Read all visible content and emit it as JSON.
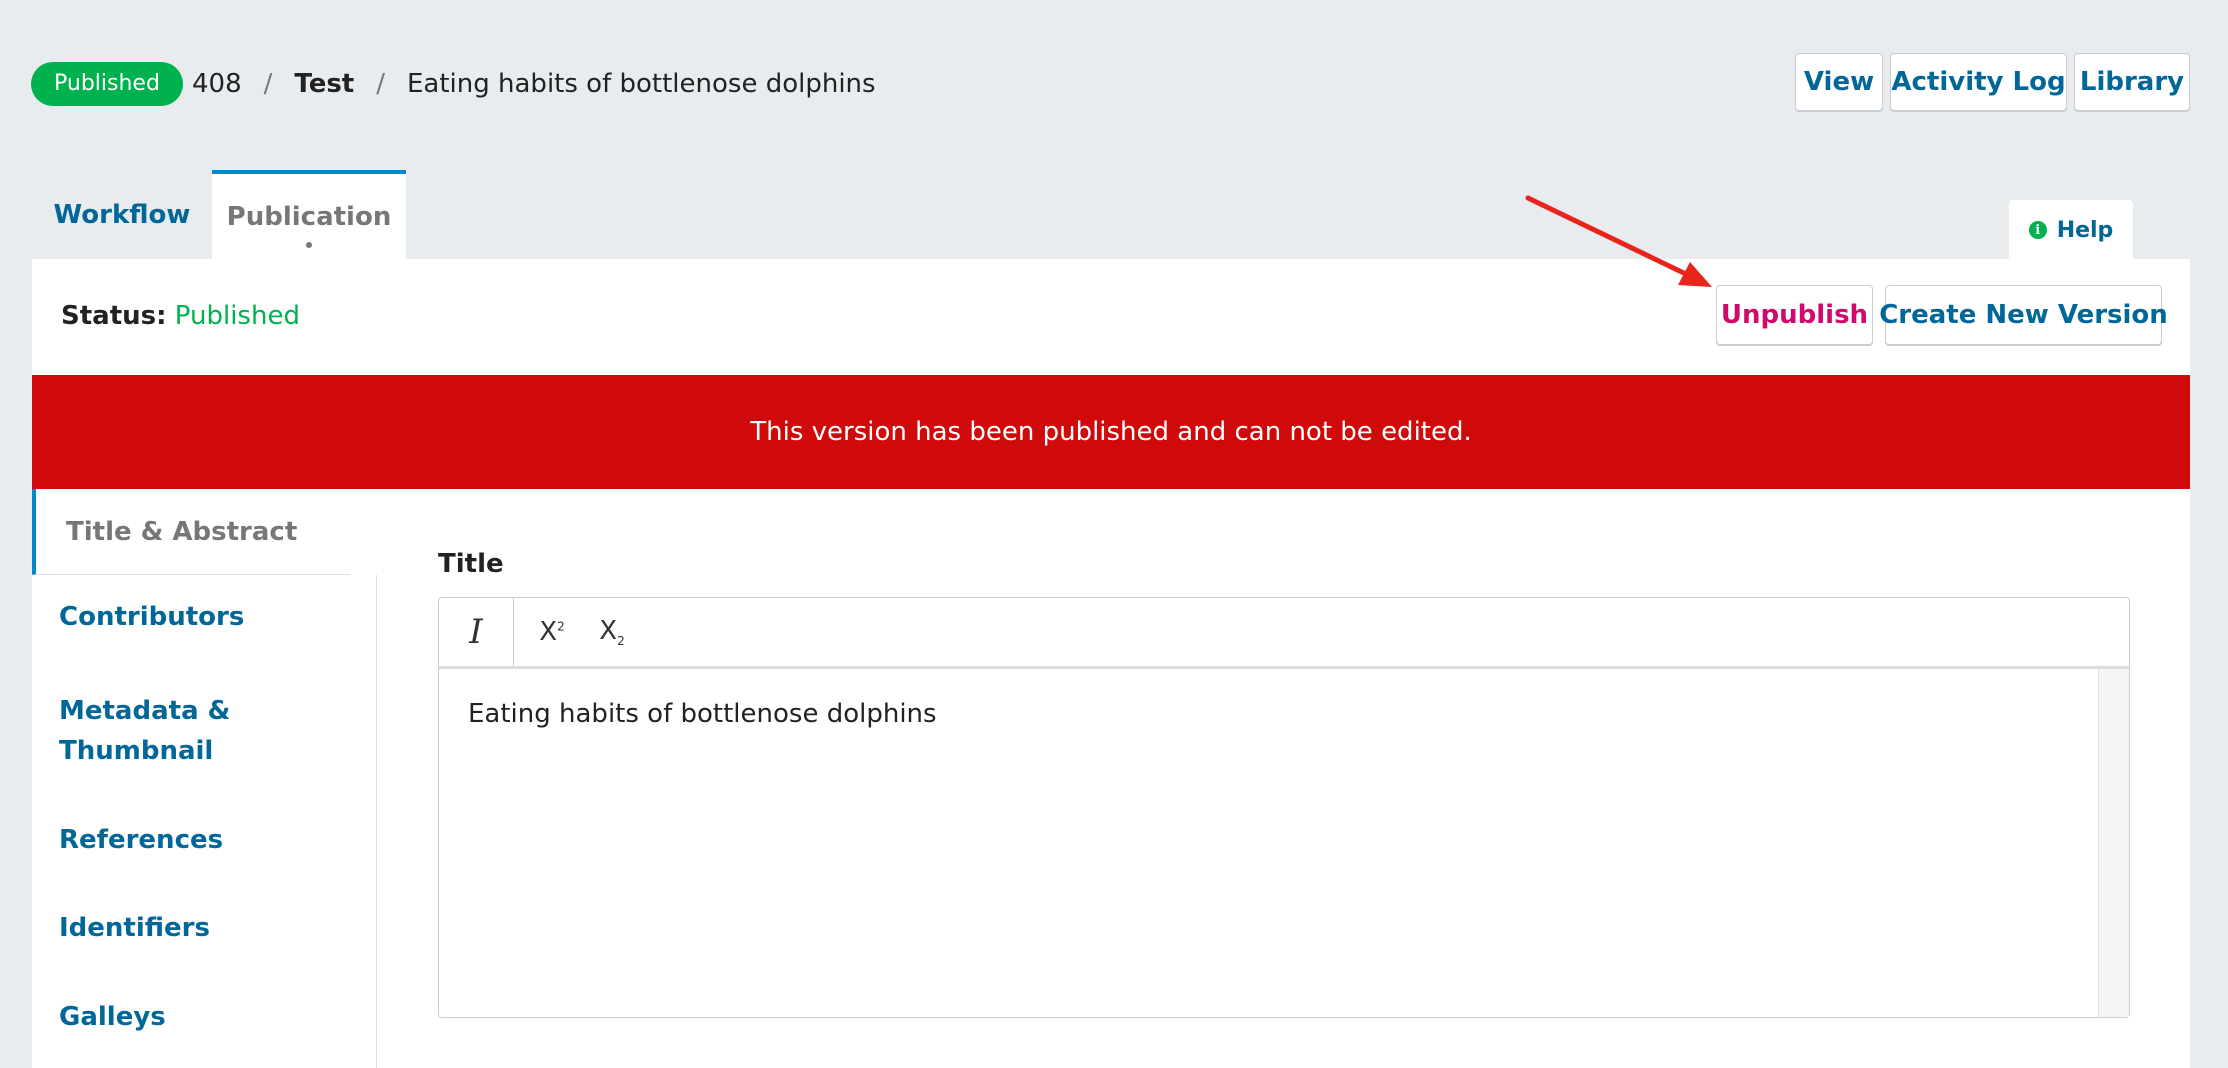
{
  "header": {
    "status_pill": "Published",
    "breadcrumb": {
      "id": "408",
      "section": "Test",
      "title": "Eating habits of bottlenose dolphins"
    },
    "buttons": {
      "view": "View",
      "activity_log": "Activity Log",
      "library": "Library"
    }
  },
  "tabs": {
    "workflow": "Workflow",
    "publication": "Publication"
  },
  "help": {
    "label": "Help",
    "icon": "info-icon"
  },
  "publication": {
    "status_label": "Status:",
    "status_value": "Published",
    "unpublish": "Unpublish",
    "create_new_version": "Create New Version",
    "banner": "This version has been published and can not be edited."
  },
  "sidenav": {
    "items": [
      {
        "label": "Title & Abstract"
      },
      {
        "label": "Contributors"
      },
      {
        "label": "Metadata &"
      },
      {
        "label": "Thumbnail"
      },
      {
        "label": "References"
      },
      {
        "label": "Identifiers"
      },
      {
        "label": "Galleys"
      }
    ]
  },
  "title_field": {
    "label": "Title",
    "value": "Eating habits of bottlenose dolphins",
    "toolbar": {
      "italic": "I",
      "superscript": "X",
      "superscript_mark": "2",
      "subscript": "X",
      "subscript_mark": "2"
    }
  },
  "colors": {
    "accent_blue": "#006798",
    "success_green": "#00b24e",
    "danger_red": "#d00a0a",
    "unpublish_pink": "#d00a6c",
    "annotation_arrow": "#e8241b"
  }
}
